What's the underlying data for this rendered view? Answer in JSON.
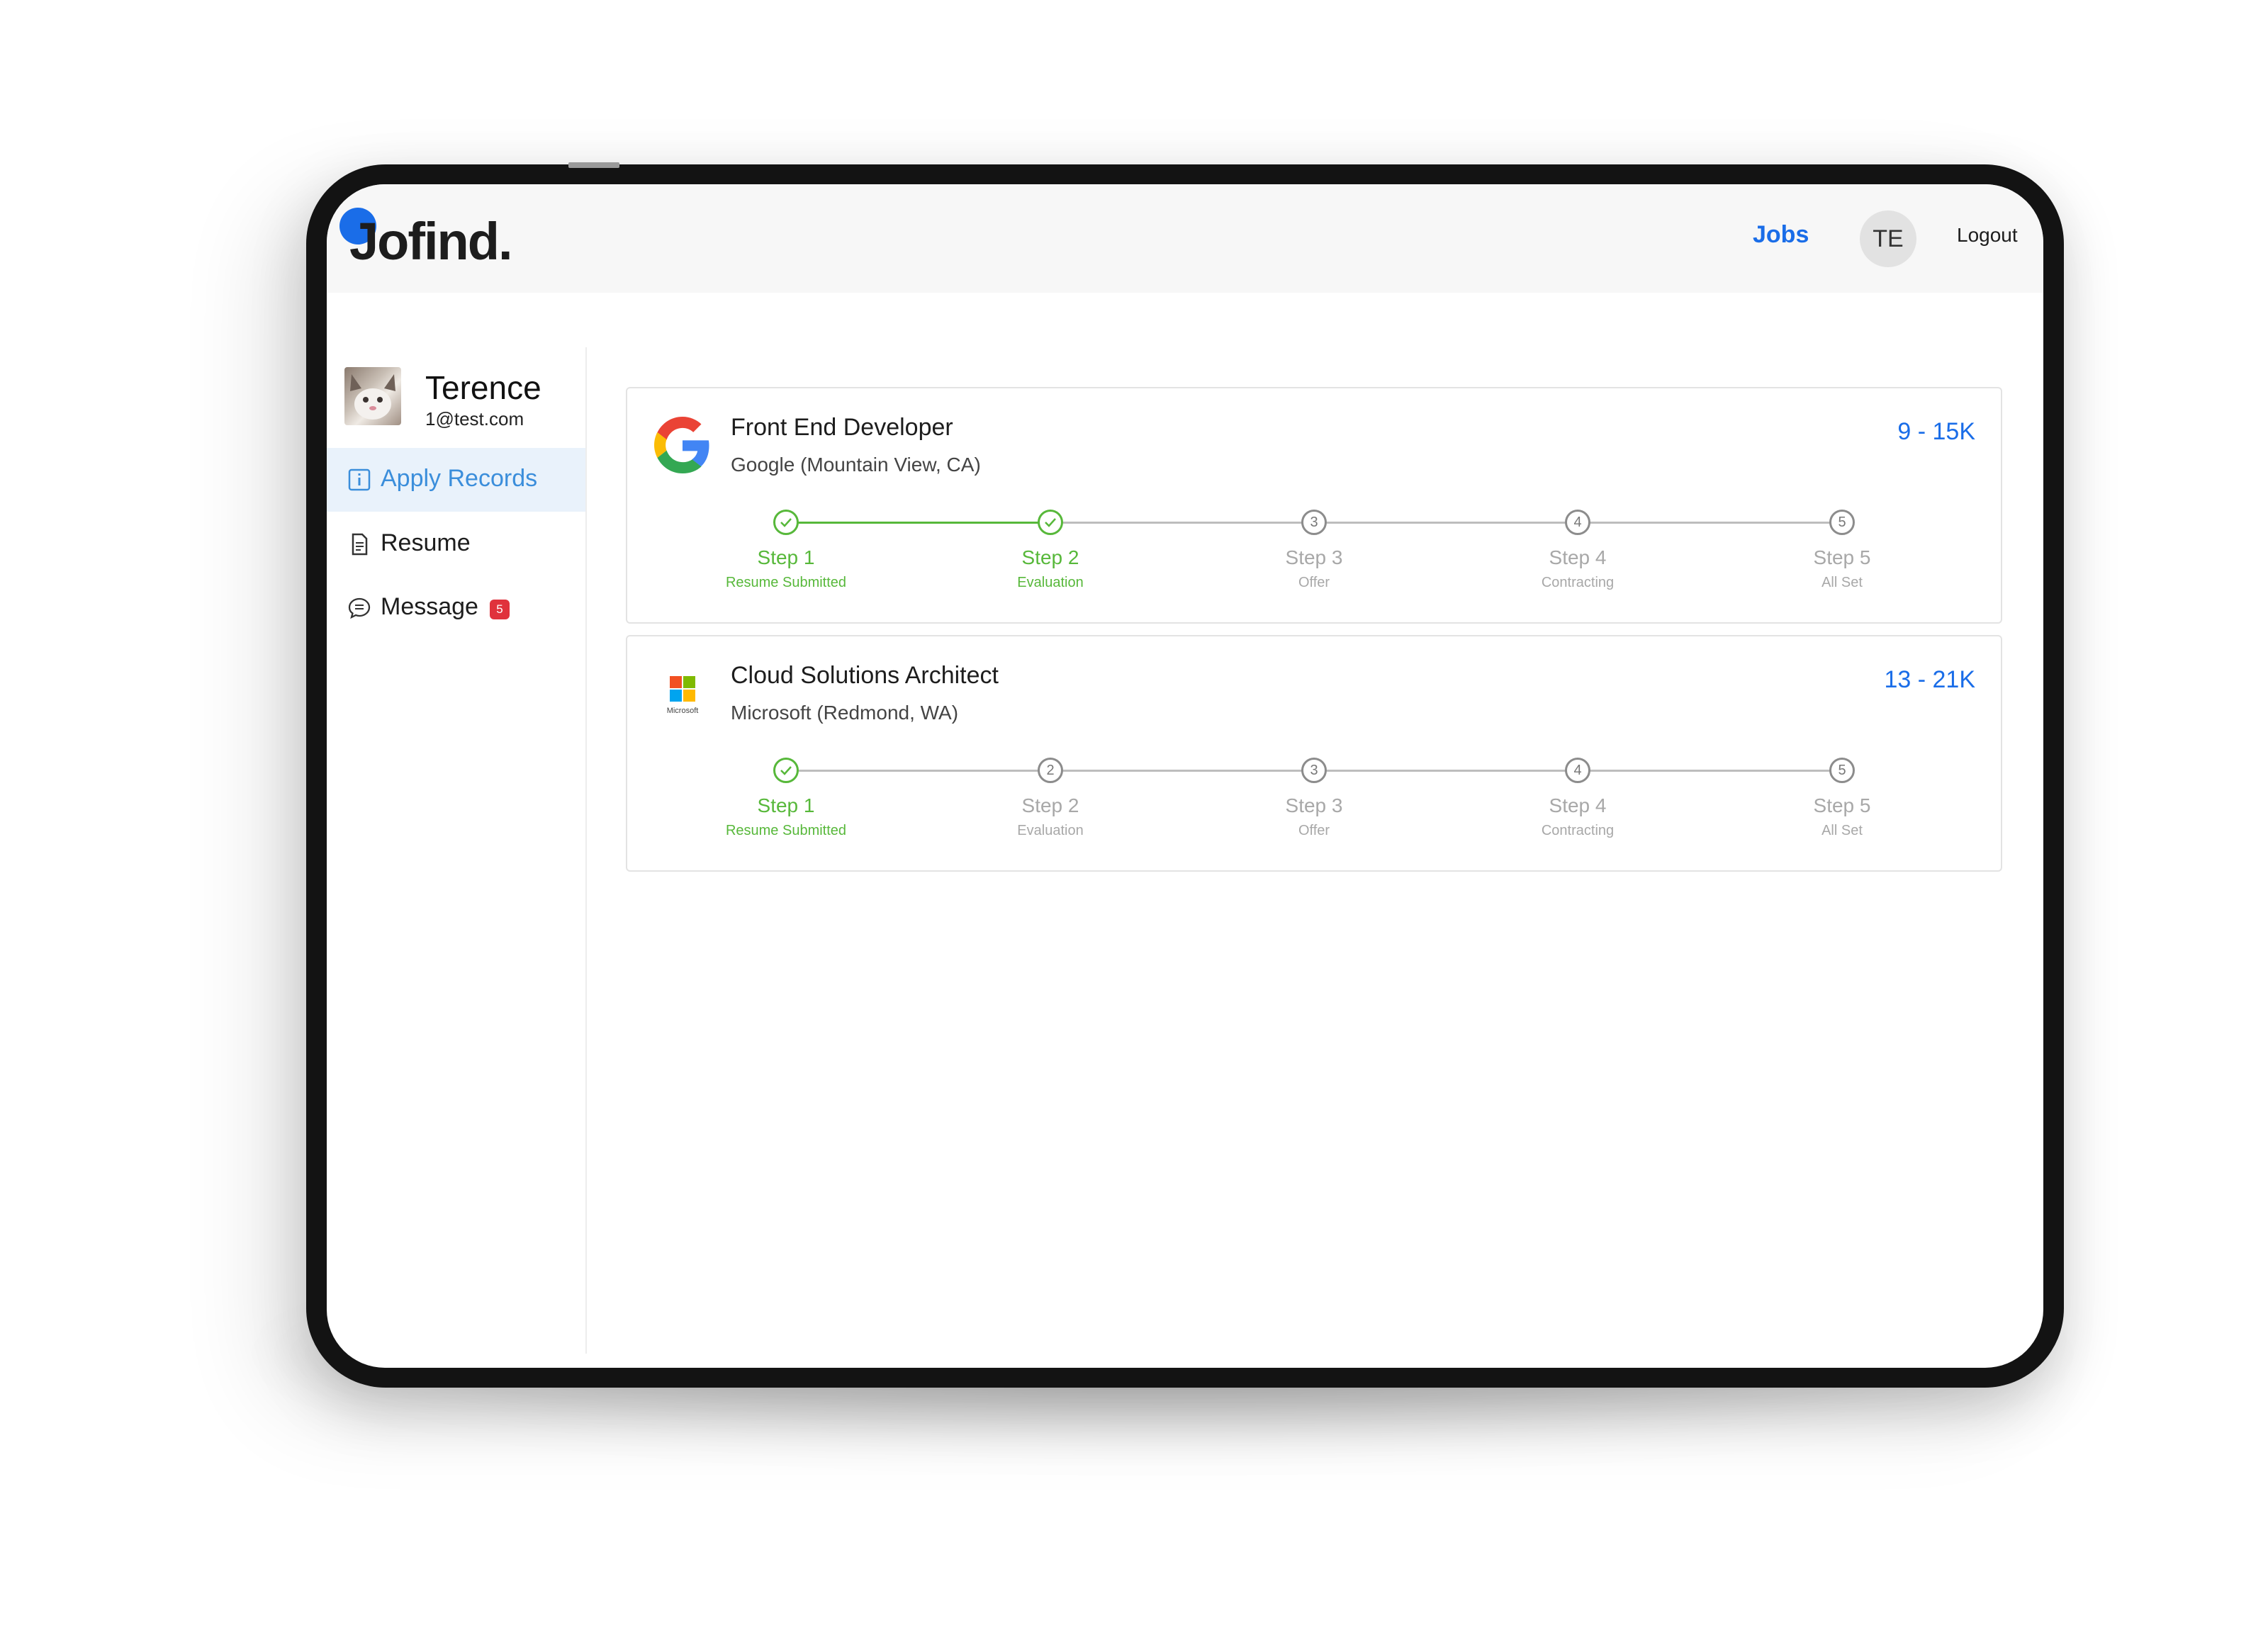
{
  "header": {
    "logo_text": "Jofind.",
    "nav_jobs": "Jobs",
    "avatar_initials": "TE",
    "logout": "Logout"
  },
  "profile": {
    "name": "Terence",
    "email": "1@test.com"
  },
  "sidebar": {
    "items": [
      {
        "label": "Apply Records",
        "icon": "info-icon",
        "active": true
      },
      {
        "label": "Resume",
        "icon": "document-icon"
      },
      {
        "label": "Message",
        "icon": "chat-icon",
        "badge": "5"
      }
    ]
  },
  "jobs": [
    {
      "title": "Front End Developer",
      "company": "Google (Mountain View, CA)",
      "salary": "9 - 15K",
      "logo": "google-logo",
      "completed_steps": 2,
      "steps": [
        {
          "num": "1",
          "title": "Step 1",
          "desc": "Resume Submitted",
          "done": true
        },
        {
          "num": "2",
          "title": "Step 2",
          "desc": "Evaluation",
          "done": true
        },
        {
          "num": "3",
          "title": "Step 3",
          "desc": "Offer",
          "done": false
        },
        {
          "num": "4",
          "title": "Step 4",
          "desc": "Contracting",
          "done": false
        },
        {
          "num": "5",
          "title": "Step 5",
          "desc": "All Set",
          "done": false
        }
      ]
    },
    {
      "title": "Cloud Solutions Architect",
      "company": "Microsoft (Redmond, WA)",
      "salary": "13 - 21K",
      "logo": "microsoft-logo",
      "logo_text": "Microsoft",
      "completed_steps": 1,
      "steps": [
        {
          "num": "1",
          "title": "Step 1",
          "desc": "Resume Submitted",
          "done": true
        },
        {
          "num": "2",
          "title": "Step 2",
          "desc": "Evaluation",
          "done": false
        },
        {
          "num": "3",
          "title": "Step 3",
          "desc": "Offer",
          "done": false
        },
        {
          "num": "4",
          "title": "Step 4",
          "desc": "Contracting",
          "done": false
        },
        {
          "num": "5",
          "title": "Step 5",
          "desc": "All Set",
          "done": false
        }
      ]
    }
  ],
  "colors": {
    "accent": "#1a6de8",
    "success": "#57b83a",
    "badge": "#e0323c",
    "active_nav": "#3b8edb"
  }
}
